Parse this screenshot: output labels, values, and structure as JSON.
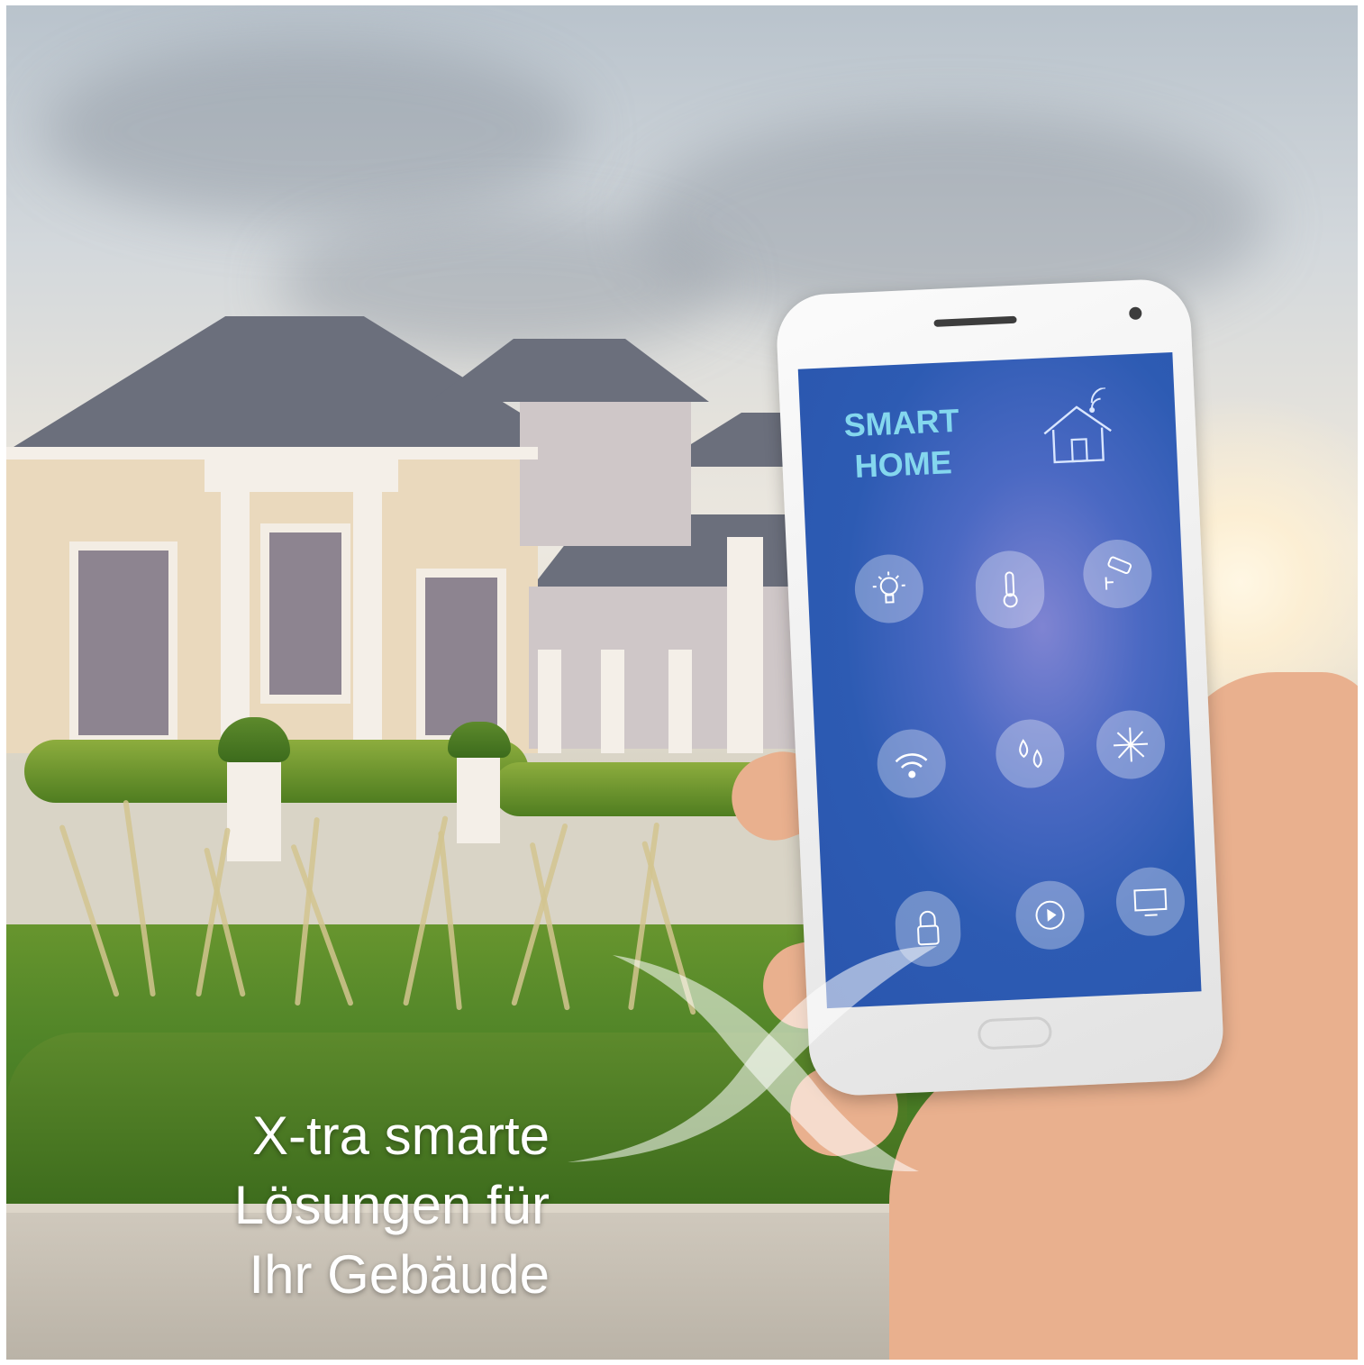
{
  "phone_screen": {
    "title_line1": "SMART",
    "title_line2": "HOME",
    "app_icons": [
      "light-bulb-icon",
      "thermometer-icon",
      "security-camera-icon",
      "wifi-icon",
      "water-drops-icon",
      "snowflake-icon",
      "lock-icon",
      "play-icon",
      "tv-icon"
    ],
    "accent_color": "#84d7ee",
    "screen_color": "#2d5bb3"
  },
  "tagline": {
    "line1": "X-tra smarte",
    "line2": "Lösungen für",
    "line3": "Ihr Gebäude"
  },
  "logo": {
    "mark": "X-logo"
  }
}
